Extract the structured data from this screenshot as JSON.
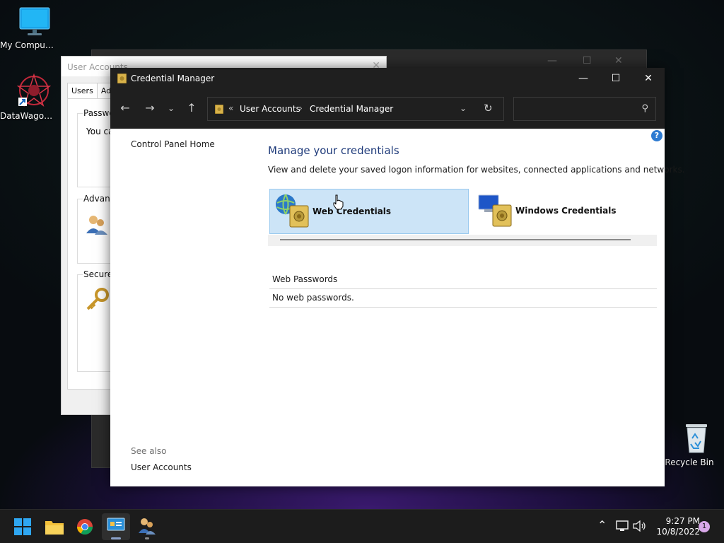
{
  "desktop": {
    "icons": [
      {
        "label": "My Computer"
      },
      {
        "label": "DataWagon..."
      },
      {
        "label": "Recycle Bin"
      }
    ]
  },
  "user_accounts_window": {
    "title": "User Accounts",
    "tabs": [
      "Users",
      "Ad"
    ],
    "group1_title": "Passwo",
    "group1_text": "You ca",
    "group2_title": "Advanc",
    "group3_title": "Secure"
  },
  "credential_manager": {
    "title": "Credential Manager",
    "address": {
      "chevrons": "«",
      "crumbs": [
        "User Accounts",
        "Credential Manager"
      ],
      "separator": "›"
    },
    "search": {
      "placeholder": "",
      "value": ""
    },
    "left_panel": {
      "control_panel_home": "Control Panel Home",
      "see_also": "See also",
      "user_accounts": "User Accounts"
    },
    "main": {
      "title": "Manage your credentials",
      "description": "View and delete your saved logon information for websites, connected applications and networks.",
      "tiles": [
        {
          "label": "Web Credentials",
          "selected": true
        },
        {
          "label": "Windows Credentials",
          "selected": false
        }
      ],
      "section_header": "Web Passwords",
      "empty_message": "No web passwords."
    }
  },
  "taskbar": {
    "time": "9:27 PM",
    "date": "10/8/2022",
    "notification_count": "1",
    "apps": [
      "start",
      "file-explorer",
      "chrome",
      "control-panel",
      "user-accounts"
    ]
  },
  "colors": {
    "title_dark": "#1f1f1f",
    "selected_tile": "#cce4f7",
    "heading_blue": "#1e3a7a",
    "help_blue": "#2e7bd1"
  }
}
